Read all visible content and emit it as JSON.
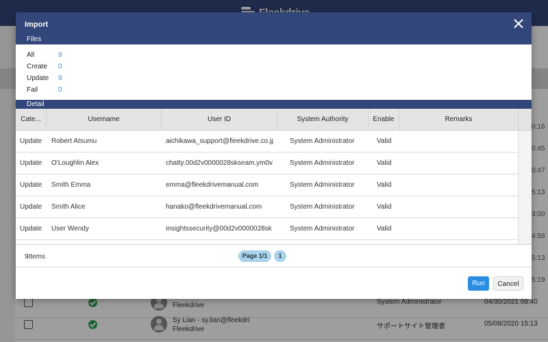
{
  "app": {
    "brand": "Fleekdrive",
    "times": [
      "0:16",
      "0:45",
      "0:47",
      "5:13",
      "3:00",
      "4:58",
      "5:13",
      "5:19"
    ],
    "background_rows": [
      {
        "name": "Fleekdrive",
        "role": "System Administrator",
        "date": "04/30/2021 09:40"
      },
      {
        "name": "Sy Lian - sy.lian@fleekdri\nFleekdrive",
        "role": "サポートサイト管理者",
        "date": "05/08/2020 15:13"
      }
    ]
  },
  "modal": {
    "title": "Import",
    "files_label": "Files",
    "detail_label": "Detail",
    "stats": [
      {
        "name": "All",
        "value": "9"
      },
      {
        "name": "Create",
        "value": "0"
      },
      {
        "name": "Update",
        "value": "9"
      },
      {
        "name": "Fail",
        "value": "0"
      }
    ],
    "columns": [
      "Cate...",
      "Username",
      "User ID",
      "System Authority",
      "Enable",
      "Remarks"
    ],
    "rows": [
      {
        "category": "Update",
        "username": "Robert Atsumu",
        "user_id": "aichikawa_support@fleekdrive.co.jp",
        "authority": "System Administrator",
        "enable": "Valid",
        "remarks": ""
      },
      {
        "category": "Update",
        "username": "O'Loughlin Alex",
        "user_id": "chatty.00d2v0000028skseam.ym0v",
        "authority": "System Administrator",
        "enable": "Valid",
        "remarks": ""
      },
      {
        "category": "Update",
        "username": "Smith Emma",
        "user_id": "emma@fleekdrivemanual.com",
        "authority": "System Administrator",
        "enable": "Valid",
        "remarks": ""
      },
      {
        "category": "Update",
        "username": "Smith Alice",
        "user_id": "hanako@fleekdrivemanual.com",
        "authority": "System Administrator",
        "enable": "Valid",
        "remarks": ""
      },
      {
        "category": "Update",
        "username": "User Wendy",
        "user_id": "insightssecurity@00d2v0000028sk",
        "authority": "System Administrator",
        "enable": "Valid",
        "remarks": ""
      }
    ],
    "item_count": "9Items",
    "page_label": "Page 1/1",
    "page_number": "1",
    "run_label": "Run",
    "cancel_label": "Cancel"
  }
}
